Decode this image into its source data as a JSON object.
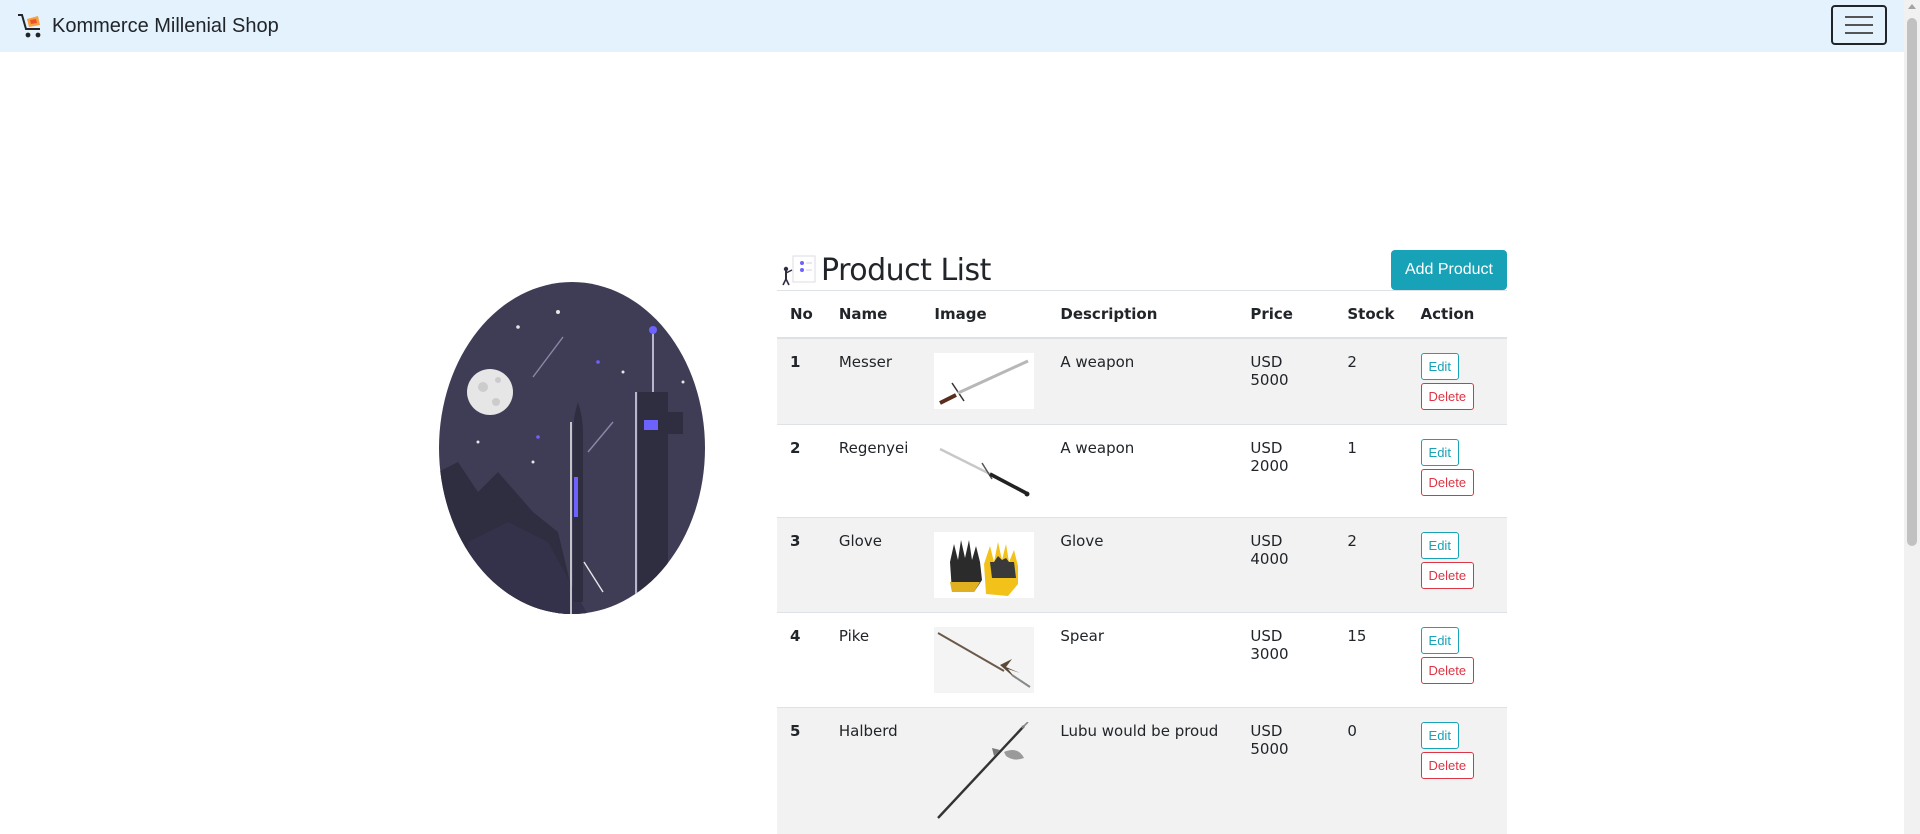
{
  "navbar": {
    "brand": "Kommerce Millenial Shop"
  },
  "page": {
    "title": "Product List",
    "add_button": "Add Product"
  },
  "table": {
    "headers": [
      "No",
      "Name",
      "Image",
      "Description",
      "Price",
      "Stock",
      "Action"
    ],
    "rows": [
      {
        "no": "1",
        "name": "Messer",
        "image": "sword-image",
        "description": "A weapon",
        "price": "USD 5000",
        "stock": "2"
      },
      {
        "no": "2",
        "name": "Regenyei",
        "image": "longsword-image",
        "description": "A weapon",
        "price": "USD 2000",
        "stock": "1"
      },
      {
        "no": "3",
        "name": "Glove",
        "image": "gloves-image",
        "description": "Glove",
        "price": "USD 4000",
        "stock": "2"
      },
      {
        "no": "4",
        "name": "Pike",
        "image": "spear-image",
        "description": "Spear",
        "price": "USD 3000",
        "stock": "15"
      },
      {
        "no": "5",
        "name": "Halberd",
        "image": "halberd-image",
        "description": "Lubu would be proud",
        "price": "USD 5000",
        "stock": "0"
      }
    ],
    "edit_label": "Edit",
    "delete_label": "Delete"
  },
  "colors": {
    "navbar_bg": "#e3f2fd",
    "accent_info": "#17a2b8",
    "danger": "#dc3545",
    "hero_night": "#3f3d56"
  },
  "icons": {
    "brand": "shopping-cart-icon",
    "menu": "hamburger-menu-icon",
    "title": "product-list-illustration-icon"
  }
}
